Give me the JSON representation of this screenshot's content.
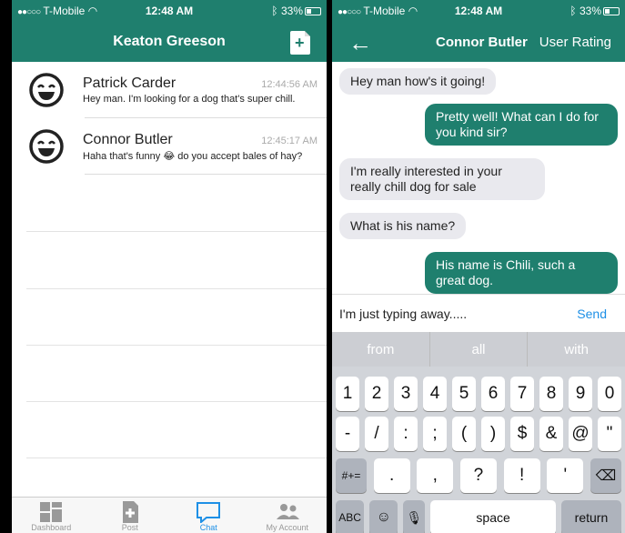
{
  "left": {
    "status": {
      "carrier": "T-Mobile",
      "time": "12:48 AM",
      "battery": "33%"
    },
    "nav": {
      "title": "Keaton Greeson"
    },
    "chats": [
      {
        "name": "Patrick Carder",
        "time": "12:44:56 AM",
        "preview": "Hey man. I'm looking for a dog that's super chill."
      },
      {
        "name": "Connor Butler",
        "time": "12:45:17 AM",
        "preview": "Haha that's funny 😂 do you accept bales of hay?"
      }
    ],
    "tabs": [
      {
        "label": "Dashboard",
        "icon": "dashboard-icon"
      },
      {
        "label": "Post",
        "icon": "post-icon"
      },
      {
        "label": "Chat",
        "icon": "chat-icon",
        "active": true
      },
      {
        "label": "My Account",
        "icon": "account-icon"
      }
    ]
  },
  "right": {
    "status": {
      "carrier": "T-Mobile",
      "time": "12:48 AM",
      "battery": "33%"
    },
    "nav": {
      "title": "Connor Butler",
      "rating": "User Rating"
    },
    "messages": [
      {
        "dir": "in",
        "text": "Hey man how's it going!"
      },
      {
        "dir": "out",
        "text": "Pretty well! What can I do for you kind sir?"
      },
      {
        "dir": "in",
        "text": "I'm really interested in your really chill dog for sale"
      },
      {
        "dir": "in",
        "text": "What is his name?"
      },
      {
        "dir": "out",
        "text": "His name is Chili, such a great dog."
      }
    ],
    "composer": {
      "value": "I'm just typing away.....",
      "send": "Send"
    },
    "keyboard": {
      "suggestions": [
        "from",
        "all",
        "with"
      ],
      "row1": [
        "1",
        "2",
        "3",
        "4",
        "5",
        "6",
        "7",
        "8",
        "9",
        "0"
      ],
      "row2": [
        "-",
        "/",
        ":",
        ";",
        "(",
        ")",
        "$",
        "&",
        "@",
        "\""
      ],
      "row3": [
        ".",
        ",",
        "?",
        "!",
        "'"
      ],
      "row3_left": "#+=",
      "row4": {
        "abc": "ABC",
        "space": "space",
        "return": "return"
      }
    }
  },
  "colors": {
    "accent": "#1f7f6e",
    "link": "#1e90e6"
  }
}
